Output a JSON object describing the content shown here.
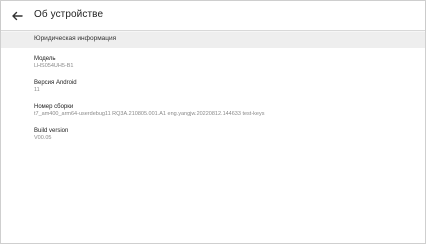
{
  "header": {
    "title": "Об устройстве",
    "back_icon": "arrow-back-icon"
  },
  "section": {
    "title": "Юридическая информация"
  },
  "items": [
    {
      "label": "Модель",
      "value": "LHS054UH5-B1"
    },
    {
      "label": "Версия Android",
      "value": "11"
    },
    {
      "label": "Номер сборки",
      "value": "t7_am400_arm64-userdebug11 RQ3A.210805.001.A1 eng.yangjw.20220812.144633 test-keys"
    },
    {
      "label": "Build version",
      "value": "V00.05"
    }
  ]
}
